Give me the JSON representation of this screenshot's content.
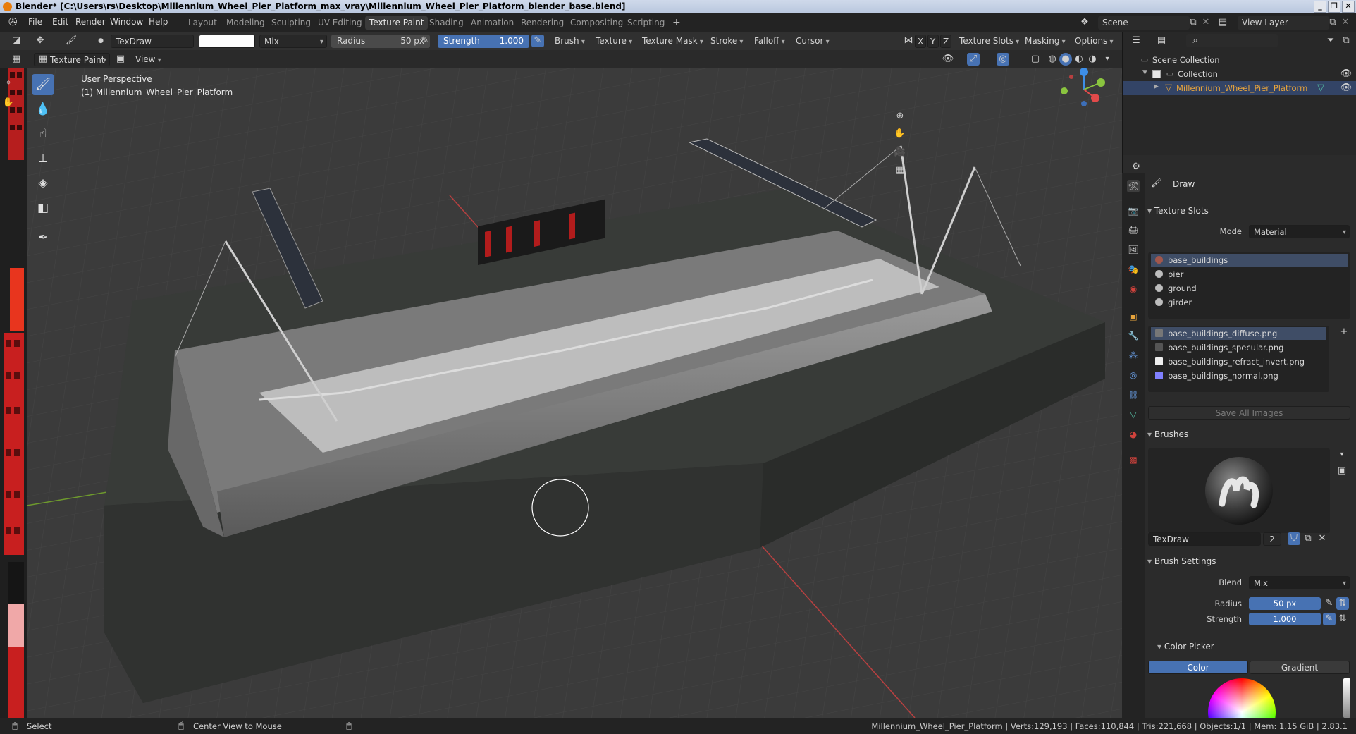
{
  "window": {
    "title": "Blender* [C:\\Users\\rs\\Desktop\\Millennium_Wheel_Pier_Platform_max_vray\\Millennium_Wheel_Pier_Platform_blender_base.blend]",
    "controls": [
      "_",
      "❐",
      "✕"
    ]
  },
  "menu": {
    "items": [
      "File",
      "Edit",
      "Render",
      "Window",
      "Help"
    ],
    "workspaces": [
      "Layout",
      "Modeling",
      "Sculpting",
      "UV Editing",
      "Texture Paint",
      "Shading",
      "Animation",
      "Rendering",
      "Compositing",
      "Scripting"
    ],
    "active_workspace": "Texture Paint",
    "add_tab": "+",
    "scene": "Scene",
    "view_layer": "View Layer"
  },
  "tool_header": {
    "brush_name": "TexDraw",
    "blend": "Mix",
    "radius_label": "Radius",
    "radius_value": "50 px",
    "strength_label": "Strength",
    "strength_value": "1.000",
    "strength_fraction": 1.0,
    "menus": [
      "Brush",
      "Texture",
      "Texture Mask",
      "Stroke",
      "Falloff",
      "Cursor"
    ],
    "axes": [
      "X",
      "Y",
      "Z"
    ],
    "right_menus": [
      "Texture Slots",
      "Masking",
      "Options"
    ]
  },
  "sub_header": {
    "mode": "Texture Paint",
    "view": "View"
  },
  "viewport": {
    "perspective": "User Perspective",
    "object_line": "(1) Millennium_Wheel_Pier_Platform",
    "accent_colors": {
      "x_axis": "#e24a4a",
      "y_axis": "#8ac43f",
      "z_axis": "#3d8ee8",
      "active_tool": "#4772b3"
    },
    "brush_cursor_radius_px": 50
  },
  "outliner": {
    "search_placeholder": "",
    "rows": [
      {
        "label": "Scene Collection",
        "icon": "collection-icon"
      },
      {
        "label": "Collection",
        "icon": "collection-icon"
      },
      {
        "label": "Millennium_Wheel_Pier_Platform",
        "icon": "mesh-icon"
      }
    ]
  },
  "properties": {
    "tool_name": "Draw",
    "texture_slots": {
      "header": "Texture Slots",
      "mode_label": "Mode",
      "mode_value": "Material",
      "materials": [
        "base_buildings",
        "pier",
        "ground",
        "girder"
      ],
      "images": [
        "base_buildings_diffuse.png",
        "base_buildings_specular.png",
        "base_buildings_refract_invert.png",
        "base_buildings_normal.png"
      ],
      "save_all": "Save All Images"
    },
    "brushes": {
      "header": "Brushes",
      "name": "TexDraw",
      "users": "2"
    },
    "brush_settings": {
      "header": "Brush Settings",
      "blend_label": "Blend",
      "blend_value": "Mix",
      "radius_label": "Radius",
      "radius_value": "50 px",
      "strength_label": "Strength",
      "strength_value": "1.000"
    },
    "color_picker": {
      "header": "Color Picker",
      "tabs": [
        "Color",
        "Gradient"
      ],
      "active_tab": "Color"
    }
  },
  "status": {
    "select": "Select",
    "center_view": "Center View to Mouse",
    "stats": "Millennium_Wheel_Pier_Platform | Verts:129,193 | Faces:110,844 | Tris:221,668 | Objects:1/1 | Mem: 1.15 GiB | 2.83.1"
  }
}
